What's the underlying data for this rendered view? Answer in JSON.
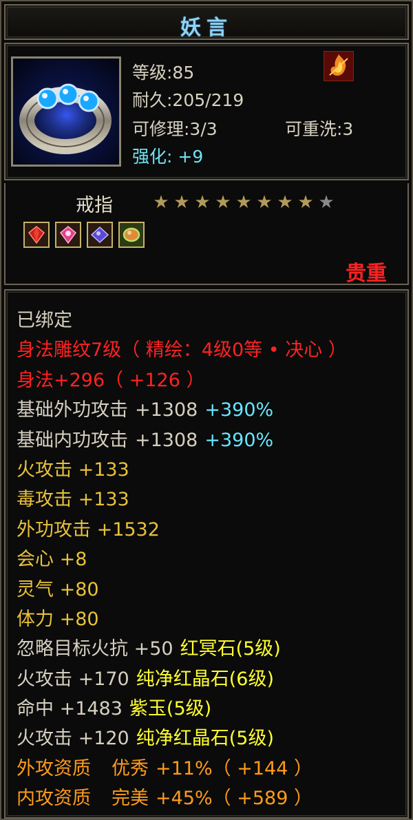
{
  "item": {
    "name": "妖言",
    "level": "等级:85",
    "durability": "耐久:205/219",
    "repairable": "可修理:3/3",
    "rewashable": "可重洗:3",
    "enhance_label": "强化:",
    "enhance_value": "+9",
    "type": "戒指",
    "stars_total": 9,
    "stars_lit": 8,
    "rarity": "贵重",
    "badge_icon": "flame-icon",
    "portrait_icon": "ring-with-blue-gems"
  },
  "gem_slots": [
    {
      "icon": "red-gem-icon",
      "color": "#c8201a"
    },
    {
      "icon": "pink-gem-icon",
      "color": "#e0408a"
    },
    {
      "icon": "purple-gem-icon",
      "color": "#5a4ad8"
    },
    {
      "icon": "green-orange-gem-icon",
      "color": "#e08a3a"
    }
  ],
  "attributes": {
    "bound": "已绑定",
    "engrave": "身法雕纹7级（ 精绘：4级0等 • 决心 ）",
    "shenfa_base": "身法+296",
    "shenfa_bonus": "（ +126 ）",
    "base_outer_label": "基础外功攻击",
    "base_outer_value": "+1308",
    "base_outer_pct": "+390%",
    "base_inner_label": "基础内功攻击",
    "base_inner_value": "+1308",
    "base_inner_pct": "+390%",
    "fire_attack": "火攻击 +133",
    "poison_attack": "毒攻击 +133",
    "outer_attack": "外功攻击 +1532",
    "crit": "会心 +8",
    "spirit": "灵气 +80",
    "stamina": "体力 +80",
    "gem1_stat": "忽略目标火抗 +50",
    "gem1_name": "红冥石",
    "gem1_level": "(5级)",
    "gem2_stat": "火攻击 +170",
    "gem2_name": "纯净红晶石",
    "gem2_level": "(6级)",
    "gem3_stat": "命中 +1483",
    "gem3_name": "紫玉",
    "gem3_level": "(5级)",
    "gem4_stat": "火攻击 +120",
    "gem4_name": "纯净红晶石",
    "gem4_level": "(5级)",
    "apt_outer_label": "外攻资质",
    "apt_outer_grade": "优秀",
    "apt_outer_value": "+11%（ +144 ）",
    "apt_inner_label": "内攻资质",
    "apt_inner_grade": "完美",
    "apt_inner_value": "+45%（ +589 ）"
  },
  "colors": {
    "title": "#8fd3f7",
    "enhance": "#6fe3f0",
    "rarity": "#ff2222",
    "engrave": "#ff2222",
    "bonus_percent": "#66e6ff",
    "elemental": "#e8c23a",
    "gem_name": "#ffff30",
    "aptitude": "#ff9c1a"
  }
}
